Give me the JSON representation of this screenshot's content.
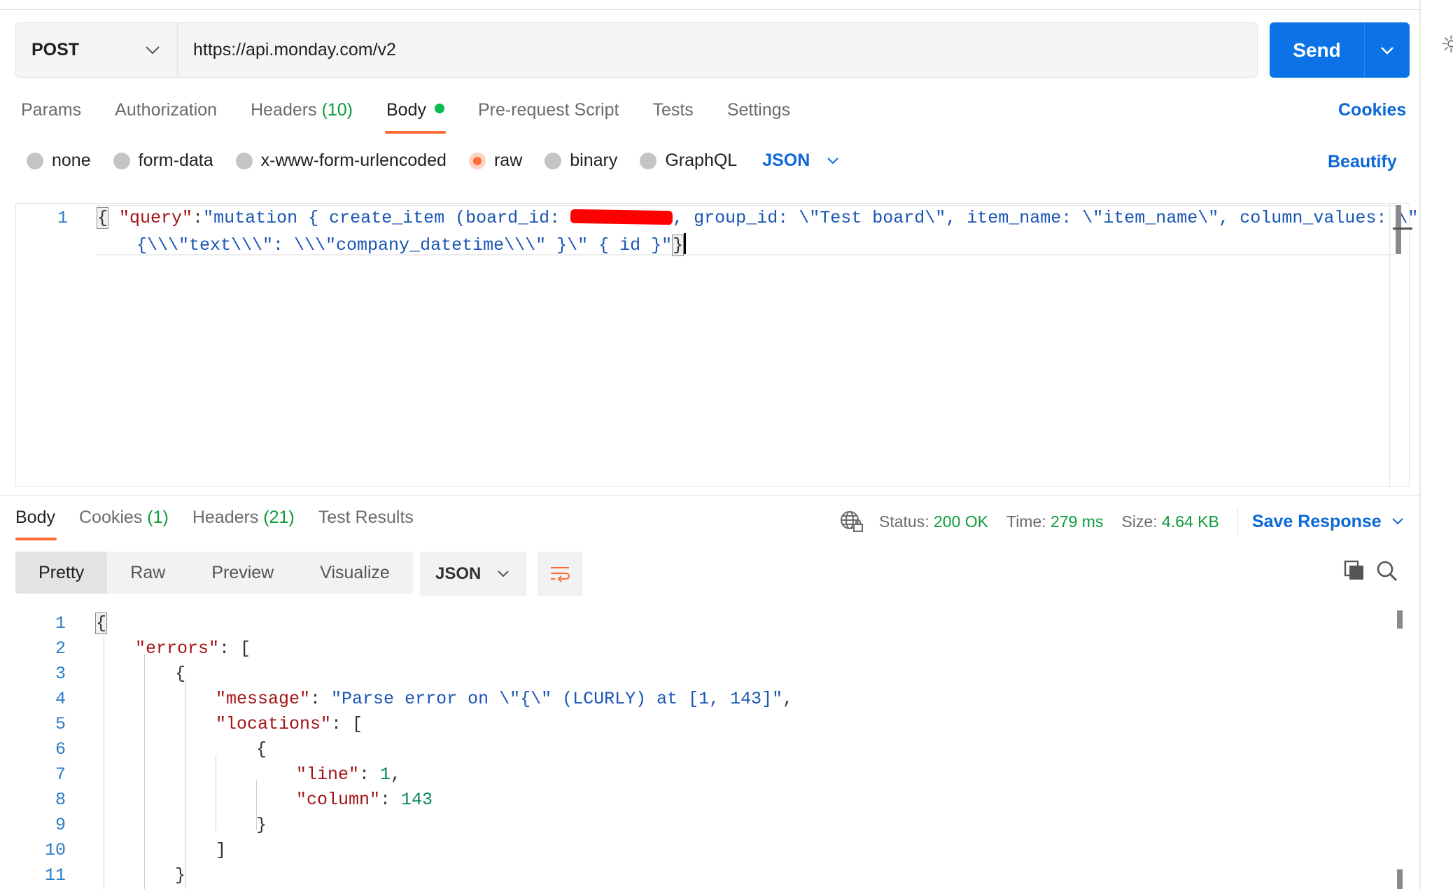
{
  "request": {
    "method": "POST",
    "url": "https://api.monday.com/v2",
    "send_label": "Send",
    "tabs": [
      {
        "label": "Params"
      },
      {
        "label": "Authorization"
      },
      {
        "label": "Headers",
        "count": "(10)"
      },
      {
        "label": "Body"
      },
      {
        "label": "Pre-request Script"
      },
      {
        "label": "Tests"
      },
      {
        "label": "Settings"
      }
    ],
    "cookies_label": "Cookies",
    "body_modes": [
      "none",
      "form-data",
      "x-www-form-urlencoded",
      "raw",
      "binary",
      "GraphQL"
    ],
    "selected_mode": "raw",
    "format": "JSON",
    "beautify_label": "Beautify",
    "editor": {
      "line_number": "1",
      "line1_open": "{",
      "line1_key": "\"query\"",
      "line1_colon": ":",
      "line1_text_a": "\"mutation { create_item (board_id: ",
      "line1_text_b": ", group_id: \\\"Test board\\\", item_name: \\\"item_name\\\", column_values: \\\"",
      "line2_text": "{\\\\\\\"text\\\\\\\": \\\\\\\"company_datetime\\\\\\\" }\\\" { id }\"",
      "line2_close": "}"
    }
  },
  "response": {
    "tabs": [
      {
        "label": "Body"
      },
      {
        "label": "Cookies",
        "count": "(1)"
      },
      {
        "label": "Headers",
        "count": "(21)"
      },
      {
        "label": "Test Results"
      }
    ],
    "status_label": "Status:",
    "status_value": "200 OK",
    "time_label": "Time:",
    "time_value": "279 ms",
    "size_label": "Size:",
    "size_value": "4.64 KB",
    "save_label": "Save Response",
    "views": [
      "Pretty",
      "Raw",
      "Preview",
      "Visualize"
    ],
    "format": "JSON",
    "lines": [
      {
        "num": "1",
        "text": "{"
      },
      {
        "num": "2",
        "key": "\"errors\"",
        "rest": ": ["
      },
      {
        "num": "3",
        "text": "{"
      },
      {
        "num": "4",
        "key": "\"message\"",
        "rest": ": ",
        "str": "\"Parse error on \\\"{\\\" (LCURLY) at [1, 143]\"",
        "tail": ","
      },
      {
        "num": "5",
        "key": "\"locations\"",
        "rest": ": ["
      },
      {
        "num": "6",
        "text": "{"
      },
      {
        "num": "7",
        "key": "\"line\"",
        "rest": ": ",
        "numval": "1",
        "tail": ","
      },
      {
        "num": "8",
        "key": "\"column\"",
        "rest": ": ",
        "numval": "143"
      },
      {
        "num": "9",
        "text": "}"
      },
      {
        "num": "10",
        "text": "]"
      },
      {
        "num": "11",
        "text": "}"
      }
    ]
  },
  "icons": {
    "corner": "lightbulb-icon",
    "globe": "globe-lock-icon",
    "copy": "copy-icon",
    "search": "search-icon",
    "wrap": "wrap-lines-icon"
  },
  "colors": {
    "accent": "#ff6c37",
    "primary": "#0b73e6",
    "link": "#0b68d6",
    "success": "#0d9b3a"
  }
}
